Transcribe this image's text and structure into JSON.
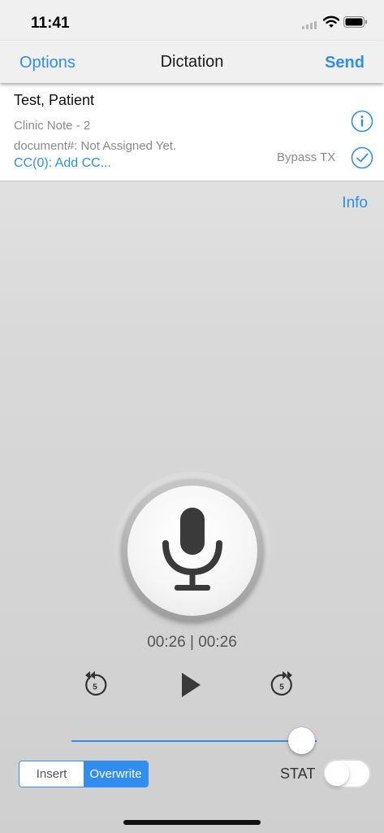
{
  "status_bar": {
    "time": "11:41"
  },
  "nav": {
    "left_label": "Options",
    "title": "Dictation",
    "right_label": "Send"
  },
  "patient": {
    "name": "Test, Patient",
    "note_type": "Clinic Note - 2",
    "document_number": "document#: Not Assigned Yet.",
    "cc_link": "CC(0): Add CC...",
    "bypass_label": "Bypass TX"
  },
  "info_link": "Info",
  "recorder": {
    "time_readout": "00:26 | 00:26",
    "skip_seconds": "5"
  },
  "slider": {
    "position_fraction": 0.95
  },
  "mode": {
    "options": [
      "Insert",
      "Overwrite"
    ],
    "selected": "Overwrite"
  },
  "stat": {
    "label": "STAT",
    "on": false
  },
  "colors": {
    "accent": "#2f8ef0"
  },
  "icons": {
    "signal": "signal-bars-icon",
    "wifi": "wifi-icon",
    "battery": "battery-icon",
    "info": "info-circle-icon",
    "check": "checkmark-circle-icon",
    "mic": "microphone-icon",
    "rewind": "rewind-5-icon",
    "play": "play-icon",
    "forward": "forward-5-icon"
  }
}
